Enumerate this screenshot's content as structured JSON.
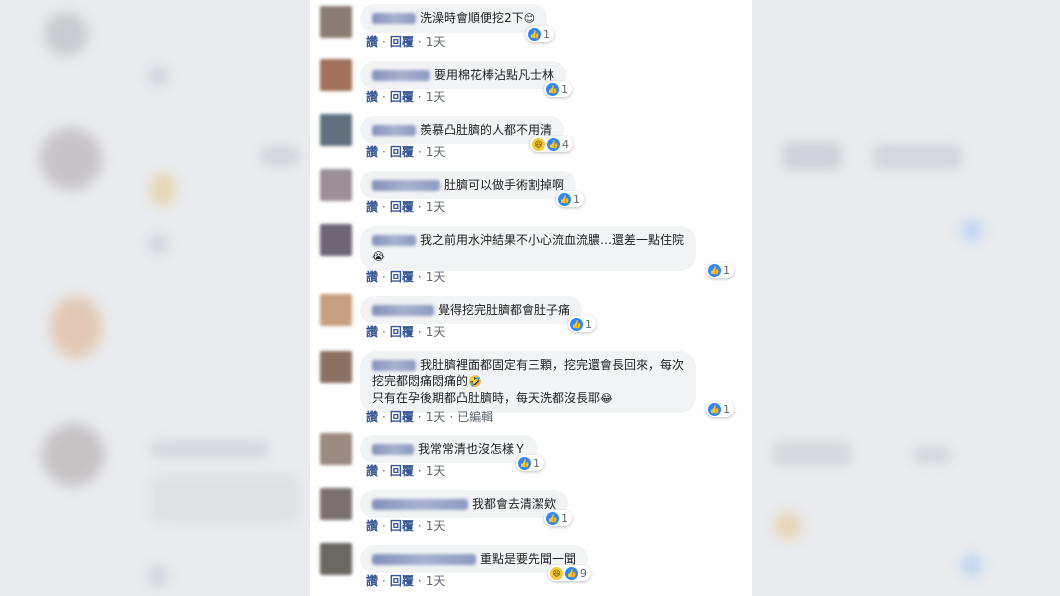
{
  "actions": {
    "like": "讚",
    "reply": "回覆",
    "sep": "·"
  },
  "comments": [
    {
      "text": "洗澡時會順便挖2下",
      "emoji": "😊",
      "time": "1天",
      "count": "1"
    },
    {
      "text": "要用棉花棒沾點凡士林",
      "time": "1天",
      "count": "1"
    },
    {
      "text": "羨慕凸肚臍的人都不用清",
      "time": "1天",
      "count": "4"
    },
    {
      "text": "肚臍可以做手術割掉啊",
      "time": "1天",
      "count": "1"
    },
    {
      "text": "我之前用水沖結果不小心流血流膿…還差一點住院",
      "emoji": "😭",
      "time": "1天",
      "count": "1"
    },
    {
      "text": "覺得挖完肚臍都會肚子痛",
      "time": "1天",
      "count": "1"
    },
    {
      "text_line1": "我肚臍裡面都固定有三顆，挖完還會長回來，每次",
      "text_line2": "挖完都悶痛悶痛的",
      "text_line3": "只有在孕後期都凸肚臍時，每天洗都沒長耶",
      "emoji2": "🤣",
      "emoji3": "😂",
      "time": "1天",
      "edited": "已編輯",
      "count": "1"
    },
    {
      "text": "我常常清也沒怎樣Ｙ",
      "time": "1天",
      "count": "1"
    },
    {
      "text": "我都會去清潔欸",
      "time": "1天",
      "count": "1"
    },
    {
      "text": "重點是要先聞一聞",
      "time": "1天",
      "count": "9"
    }
  ]
}
